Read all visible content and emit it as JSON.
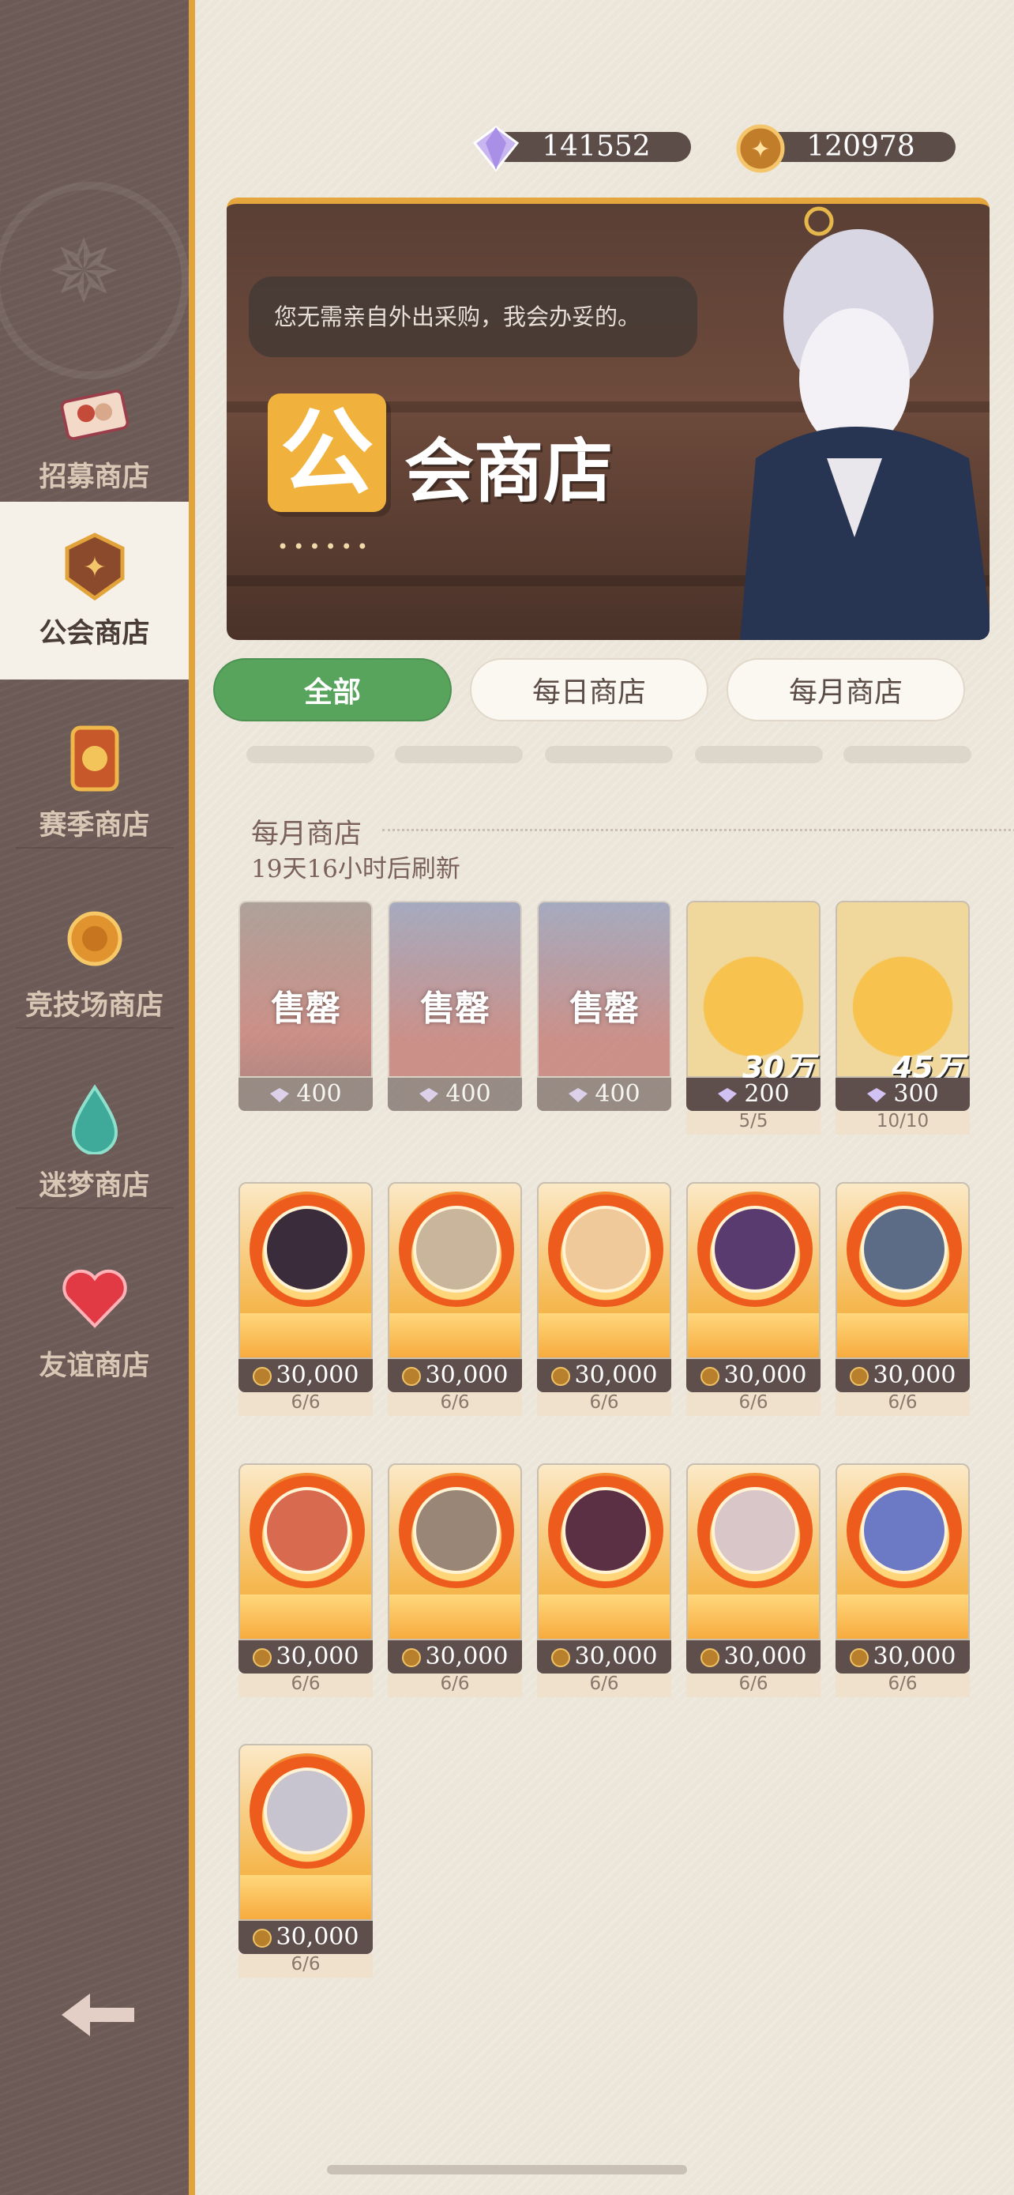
{
  "currency": {
    "diamonds": "141552",
    "guild_coins": "120978"
  },
  "sidebar": {
    "items": [
      {
        "label": "招募商店"
      },
      {
        "label": "公会商店",
        "active": true
      },
      {
        "label": "赛季商店"
      },
      {
        "label": "竞技场商店"
      },
      {
        "label": "迷梦商店"
      },
      {
        "label": "友谊商店"
      }
    ]
  },
  "banner": {
    "speech": "您无需亲自外出采购，我会办妥的。",
    "badge_char": "公",
    "title": "会商店",
    "dots": "••••••"
  },
  "tabs": [
    {
      "label": "全部",
      "active": true
    },
    {
      "label": "每日商店"
    },
    {
      "label": "每月商店"
    }
  ],
  "section": {
    "title": "每月商店",
    "refresh": "19天16小时后刷新"
  },
  "items": {
    "row1": [
      {
        "sold_label": "售罄",
        "price": "400"
      },
      {
        "sold_label": "售罄",
        "price": "400"
      },
      {
        "sold_label": "售罄",
        "price": "400"
      },
      {
        "amount": "30万",
        "price": "200",
        "stock": "5/5"
      },
      {
        "amount": "45万",
        "price": "300",
        "stock": "10/10"
      }
    ],
    "heroes": [
      {
        "price": "30,000",
        "stock": "6/6",
        "tint": "#3a2c3a"
      },
      {
        "price": "30,000",
        "stock": "6/6",
        "tint": "#c8b59b"
      },
      {
        "price": "30,000",
        "stock": "6/6",
        "tint": "#f0c99a"
      },
      {
        "price": "30,000",
        "stock": "6/6",
        "tint": "#5a3b70"
      },
      {
        "price": "30,000",
        "stock": "6/6",
        "tint": "#5d6c86"
      },
      {
        "price": "30,000",
        "stock": "6/6",
        "tint": "#d86a50"
      },
      {
        "price": "30,000",
        "stock": "6/6",
        "tint": "#9a8676"
      },
      {
        "price": "30,000",
        "stock": "6/6",
        "tint": "#5b3044"
      },
      {
        "price": "30,000",
        "stock": "6/6",
        "tint": "#d9c6c9"
      },
      {
        "price": "30,000",
        "stock": "6/6",
        "tint": "#6c7ac6"
      },
      {
        "price": "30,000",
        "stock": "6/6",
        "tint": "#c7c4cf"
      }
    ]
  }
}
